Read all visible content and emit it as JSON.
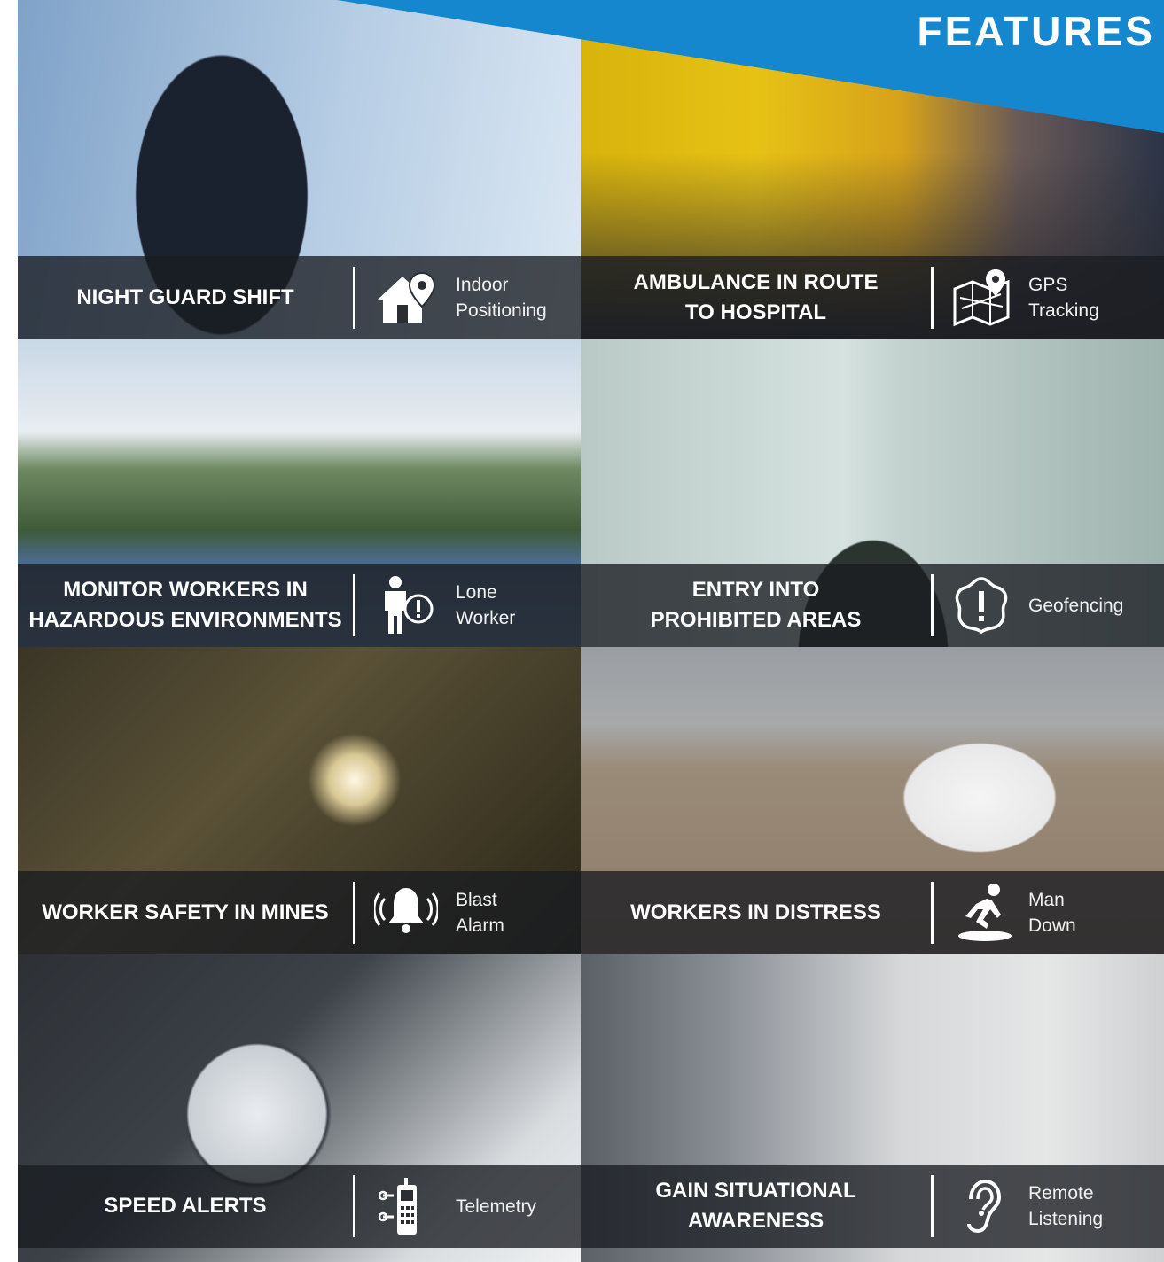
{
  "header": {
    "title": "FEATURES"
  },
  "colors": {
    "banner": "#1487cf",
    "band": "#191c21",
    "text": "#ffffff"
  },
  "cards": [
    {
      "title": "NIGHT GUARD SHIFT",
      "icon": "house-location-icon",
      "label": "Indoor\nPositioning"
    },
    {
      "title": "AMBULANCE IN ROUTE\nTO HOSPITAL",
      "icon": "map-pin-icon",
      "label": "GPS\nTracking"
    },
    {
      "title": "MONITOR WORKERS IN\nHAZARDOUS ENVIRONMENTS",
      "icon": "person-alert-icon",
      "label": "Lone\nWorker"
    },
    {
      "title": "ENTRY INTO\nPROHIBITED AREAS",
      "icon": "geofence-alert-icon",
      "label": "Geofencing"
    },
    {
      "title": "WORKER SAFETY IN MINES",
      "icon": "alarm-bell-icon",
      "label": "Blast\nAlarm"
    },
    {
      "title": "WORKERS IN DISTRESS",
      "icon": "man-down-icon",
      "label": "Man\nDown"
    },
    {
      "title": "SPEED ALERTS",
      "icon": "telemetry-device-icon",
      "label": "Telemetry"
    },
    {
      "title": "GAIN SITUATIONAL\nAWARENESS",
      "icon": "ear-icon",
      "label": "Remote\nListening"
    }
  ]
}
